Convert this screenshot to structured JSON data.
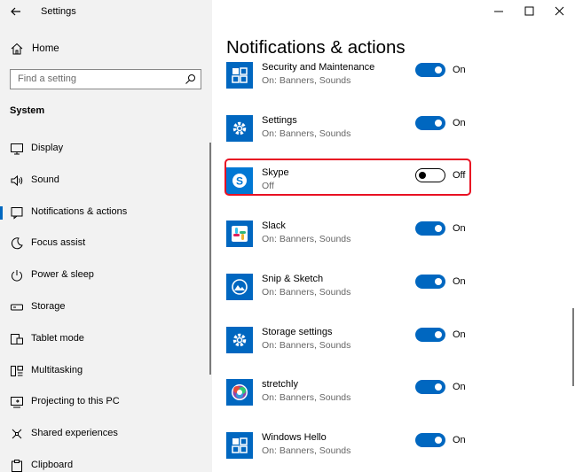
{
  "window": {
    "title": "Settings"
  },
  "sidebar": {
    "home_label": "Home",
    "search_placeholder": "Find a setting",
    "section_label": "System",
    "items": [
      {
        "label": "Display",
        "icon": "display-icon"
      },
      {
        "label": "Sound",
        "icon": "speaker-icon"
      },
      {
        "label": "Notifications & actions",
        "icon": "notification-icon",
        "active": true
      },
      {
        "label": "Focus assist",
        "icon": "moon-icon"
      },
      {
        "label": "Power & sleep",
        "icon": "power-icon"
      },
      {
        "label": "Storage",
        "icon": "storage-icon"
      },
      {
        "label": "Tablet mode",
        "icon": "tablet-icon"
      },
      {
        "label": "Multitasking",
        "icon": "multitasking-icon"
      },
      {
        "label": "Projecting to this PC",
        "icon": "projector-icon"
      },
      {
        "label": "Shared experiences",
        "icon": "shared-icon"
      },
      {
        "label": "Clipboard",
        "icon": "clipboard-icon"
      }
    ]
  },
  "main": {
    "title": "Notifications & actions",
    "apps": [
      {
        "name": "Security and Maintenance",
        "status": "On: Banners, Sounds",
        "toggle": "On",
        "on": true,
        "icon": "security-icon",
        "color": "#0067c0"
      },
      {
        "name": "Settings",
        "status": "On: Banners, Sounds",
        "toggle": "On",
        "on": true,
        "icon": "gear-icon",
        "color": "#0067c0"
      },
      {
        "name": "Skype",
        "status": "Off",
        "toggle": "Off",
        "on": false,
        "icon": "skype-icon",
        "color": "#0078d4"
      },
      {
        "name": "Slack",
        "status": "On: Banners, Sounds",
        "toggle": "On",
        "on": true,
        "icon": "slack-icon",
        "color": "#0067c0"
      },
      {
        "name": "Snip & Sketch",
        "status": "On: Banners, Sounds",
        "toggle": "On",
        "on": true,
        "icon": "snip-sketch-icon",
        "color": "#0067c0"
      },
      {
        "name": "Storage settings",
        "status": "On: Banners, Sounds",
        "toggle": "On",
        "on": true,
        "icon": "gear-icon",
        "color": "#0067c0"
      },
      {
        "name": "stretchly",
        "status": "On: Banners, Sounds",
        "toggle": "On",
        "on": true,
        "icon": "stretchly-icon",
        "color": "#0067c0"
      },
      {
        "name": "Windows Hello",
        "status": "On: Banners, Sounds",
        "toggle": "On",
        "on": true,
        "icon": "windows-hello-icon",
        "color": "#0067c0"
      }
    ]
  },
  "colors": {
    "accent": "#0067c0",
    "highlight": "#e81123",
    "sidebar_bg": "#f2f2f2"
  }
}
